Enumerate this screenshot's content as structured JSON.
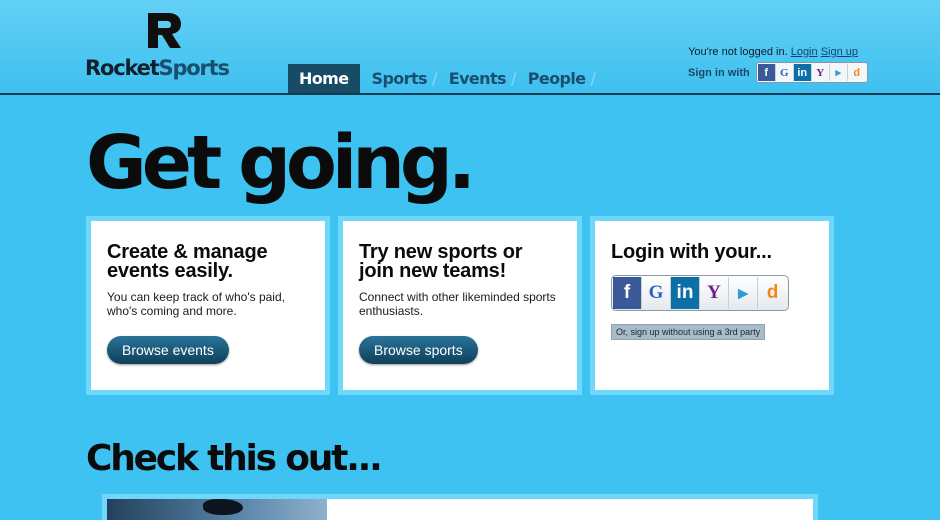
{
  "header": {
    "logo": {
      "mark": "R",
      "brand_part1": "Rocket",
      "brand_part2": "Sports"
    },
    "nav": [
      {
        "label": "Home",
        "active": true
      },
      {
        "label": "Sports",
        "separator": "/"
      },
      {
        "label": "Events",
        "separator": "/"
      },
      {
        "label": "People",
        "separator": "/"
      }
    ],
    "auth": {
      "status": "You're not logged in.",
      "login": "Login",
      "signup": "Sign up",
      "sign_in_with": "Sign in with"
    }
  },
  "providers": [
    {
      "name": "facebook-icon",
      "glyph": "f"
    },
    {
      "name": "google-icon",
      "glyph": "G"
    },
    {
      "name": "linkedin-icon",
      "glyph": "in"
    },
    {
      "name": "yahoo-icon",
      "glyph": "Y"
    },
    {
      "name": "aim-icon",
      "glyph": "▸"
    },
    {
      "name": "openid-icon",
      "glyph": "d"
    }
  ],
  "hero": {
    "title": "Get going."
  },
  "cards": [
    {
      "heading": "Create & manage events easily.",
      "body": "You can keep track of who's paid, who's coming and more.",
      "button": "Browse events"
    },
    {
      "heading": "Try new sports or join new teams!",
      "body": "Connect with other likeminded sports enthusiasts.",
      "button": "Browse sports"
    },
    {
      "heading": "Login with your...",
      "alt_signup": "Or, sign up without using a 3rd party"
    }
  ],
  "section": {
    "title": "Check this out..."
  },
  "colors": {
    "background": "#3ec2f2",
    "header_border": "#123a52",
    "nav_active": "#174b66",
    "button": "#0f3f59",
    "card_border": "#6ed7fa"
  }
}
